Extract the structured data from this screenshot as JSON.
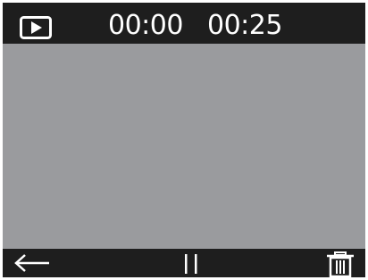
{
  "player": {
    "mode_icon": "play-mode-icon",
    "current_time": "00:00",
    "total_time": "00:25"
  },
  "controls": {
    "back_icon": "arrow-left-icon",
    "pause_icon": "pause-icon",
    "delete_icon": "trash-icon"
  },
  "colors": {
    "bar_background": "#1e1e1e",
    "viewport_background": "#9a9b9e",
    "foreground": "#ffffff"
  }
}
